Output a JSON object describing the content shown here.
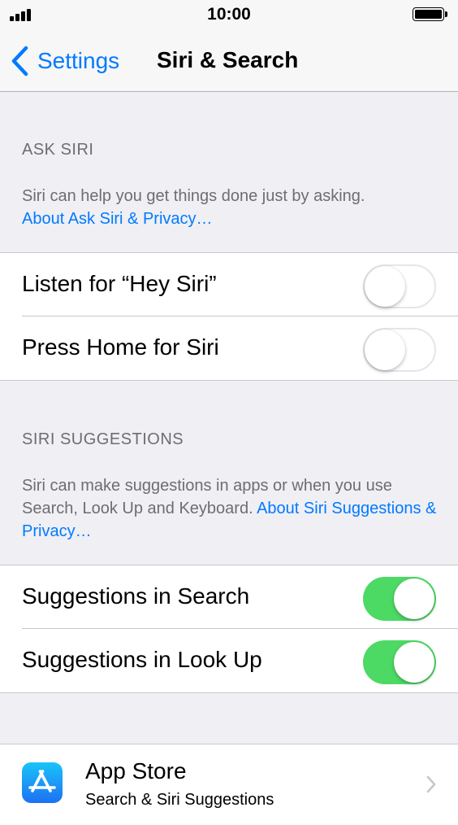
{
  "status_bar": {
    "time": "10:00"
  },
  "nav": {
    "back_label": "Settings",
    "title": "Siri & Search"
  },
  "ask_siri": {
    "header": "ASK SIRI",
    "description": "Siri can help you get things done just by asking.",
    "link": "About Ask Siri & Privacy…",
    "rows": [
      {
        "label": "Listen for “Hey Siri”",
        "enabled": false
      },
      {
        "label": "Press Home for Siri",
        "enabled": false
      }
    ]
  },
  "siri_suggestions": {
    "header": "SIRI SUGGESTIONS",
    "description": "Siri can make suggestions in apps or when you use Search, Look Up and Keyboard.",
    "link": "About Siri Suggestions & Privacy…",
    "rows": [
      {
        "label": "Suggestions in Search",
        "enabled": true
      },
      {
        "label": "Suggestions in Look Up",
        "enabled": true
      }
    ]
  },
  "apps": [
    {
      "name": "App Store",
      "subtitle": "Search & Siri Suggestions",
      "icon": "app-store-icon"
    }
  ],
  "colors": {
    "accent": "#007aff",
    "toggle_on": "#4cd964",
    "background": "#efeff4",
    "secondary_text": "#6d6d72"
  }
}
